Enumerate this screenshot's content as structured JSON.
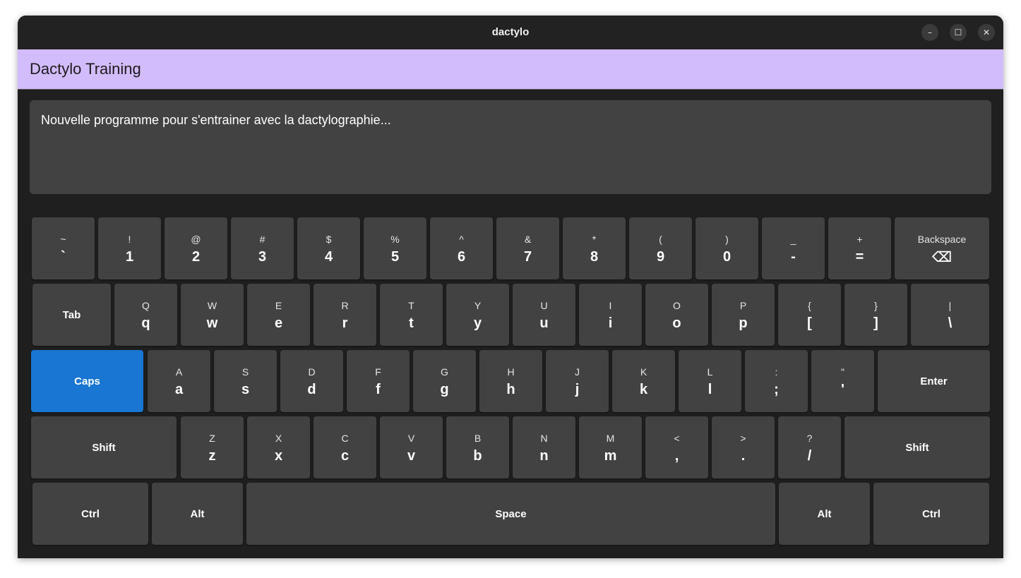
{
  "window": {
    "title": "dactylo",
    "minimize_glyph": "–",
    "maximize_glyph": "☐",
    "close_glyph": "✕"
  },
  "appbar": {
    "title": "Dactylo Training"
  },
  "textfield": {
    "value": "Nouvelle programme pour s'entrainer avec la dactylographie..."
  },
  "colors": {
    "accent": "#d3bcfb",
    "active_key": "#1976d2",
    "key": "#424242",
    "background": "#1f1f1f"
  },
  "keyboard": {
    "row1": [
      {
        "top": "~",
        "bottom": "`"
      },
      {
        "top": "!",
        "bottom": "1"
      },
      {
        "top": "@",
        "bottom": "2"
      },
      {
        "top": "#",
        "bottom": "3"
      },
      {
        "top": "$",
        "bottom": "4"
      },
      {
        "top": "%",
        "bottom": "5"
      },
      {
        "top": "^",
        "bottom": "6"
      },
      {
        "top": "&",
        "bottom": "7"
      },
      {
        "top": "*",
        "bottom": "8"
      },
      {
        "top": "(",
        "bottom": "9"
      },
      {
        "top": ")",
        "bottom": "0"
      },
      {
        "top": "_",
        "bottom": "-"
      },
      {
        "top": "+",
        "bottom": "="
      },
      {
        "top": "Backspace",
        "bottom": "⌫"
      }
    ],
    "row2": [
      {
        "label": "Tab"
      },
      {
        "top": "Q",
        "bottom": "q"
      },
      {
        "top": "W",
        "bottom": "w"
      },
      {
        "top": "E",
        "bottom": "e"
      },
      {
        "top": "R",
        "bottom": "r"
      },
      {
        "top": "T",
        "bottom": "t"
      },
      {
        "top": "Y",
        "bottom": "y"
      },
      {
        "top": "U",
        "bottom": "u"
      },
      {
        "top": "I",
        "bottom": "i"
      },
      {
        "top": "O",
        "bottom": "o"
      },
      {
        "top": "P",
        "bottom": "p"
      },
      {
        "top": "{",
        "bottom": "["
      },
      {
        "top": "}",
        "bottom": "]"
      },
      {
        "top": "|",
        "bottom": "\\"
      }
    ],
    "row3": [
      {
        "label": "Caps",
        "active": true
      },
      {
        "top": "A",
        "bottom": "a"
      },
      {
        "top": "S",
        "bottom": "s"
      },
      {
        "top": "D",
        "bottom": "d"
      },
      {
        "top": "F",
        "bottom": "f"
      },
      {
        "top": "G",
        "bottom": "g"
      },
      {
        "top": "H",
        "bottom": "h"
      },
      {
        "top": "J",
        "bottom": "j"
      },
      {
        "top": "K",
        "bottom": "k"
      },
      {
        "top": "L",
        "bottom": "l"
      },
      {
        "top": ":",
        "bottom": ";"
      },
      {
        "top": "\"",
        "bottom": "'"
      },
      {
        "label": "Enter"
      }
    ],
    "row4": [
      {
        "label": "Shift"
      },
      {
        "top": "Z",
        "bottom": "z"
      },
      {
        "top": "X",
        "bottom": "x"
      },
      {
        "top": "C",
        "bottom": "c"
      },
      {
        "top": "V",
        "bottom": "v"
      },
      {
        "top": "B",
        "bottom": "b"
      },
      {
        "top": "N",
        "bottom": "n"
      },
      {
        "top": "M",
        "bottom": "m"
      },
      {
        "top": "<",
        "bottom": ","
      },
      {
        "top": ">",
        "bottom": "."
      },
      {
        "top": "?",
        "bottom": "/"
      },
      {
        "label": "Shift"
      }
    ],
    "row5": [
      {
        "label": "Ctrl"
      },
      {
        "label": "Alt"
      },
      {
        "label": "Space"
      },
      {
        "label": "Alt"
      },
      {
        "label": "Ctrl"
      }
    ]
  }
}
